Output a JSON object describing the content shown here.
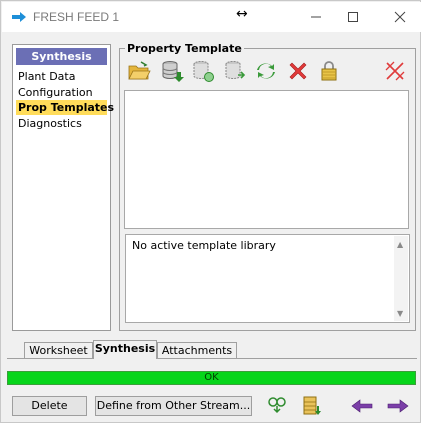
{
  "window": {
    "title": "FRESH FEED 1"
  },
  "nav": {
    "header": "Synthesis",
    "items": [
      {
        "label": "Plant Data"
      },
      {
        "label": "Configuration"
      },
      {
        "label": "Prop Templates"
      },
      {
        "label": "Diagnostics"
      }
    ]
  },
  "property_template": {
    "group_label": "Property Template",
    "message": "No active template library"
  },
  "tabs": [
    {
      "label": "Worksheet"
    },
    {
      "label": "Synthesis"
    },
    {
      "label": "Attachments"
    }
  ],
  "status": {
    "text": "OK",
    "color": "#06d51a"
  },
  "buttons": {
    "delete": "Delete",
    "define_from_other": "Define from Other Stream..."
  }
}
